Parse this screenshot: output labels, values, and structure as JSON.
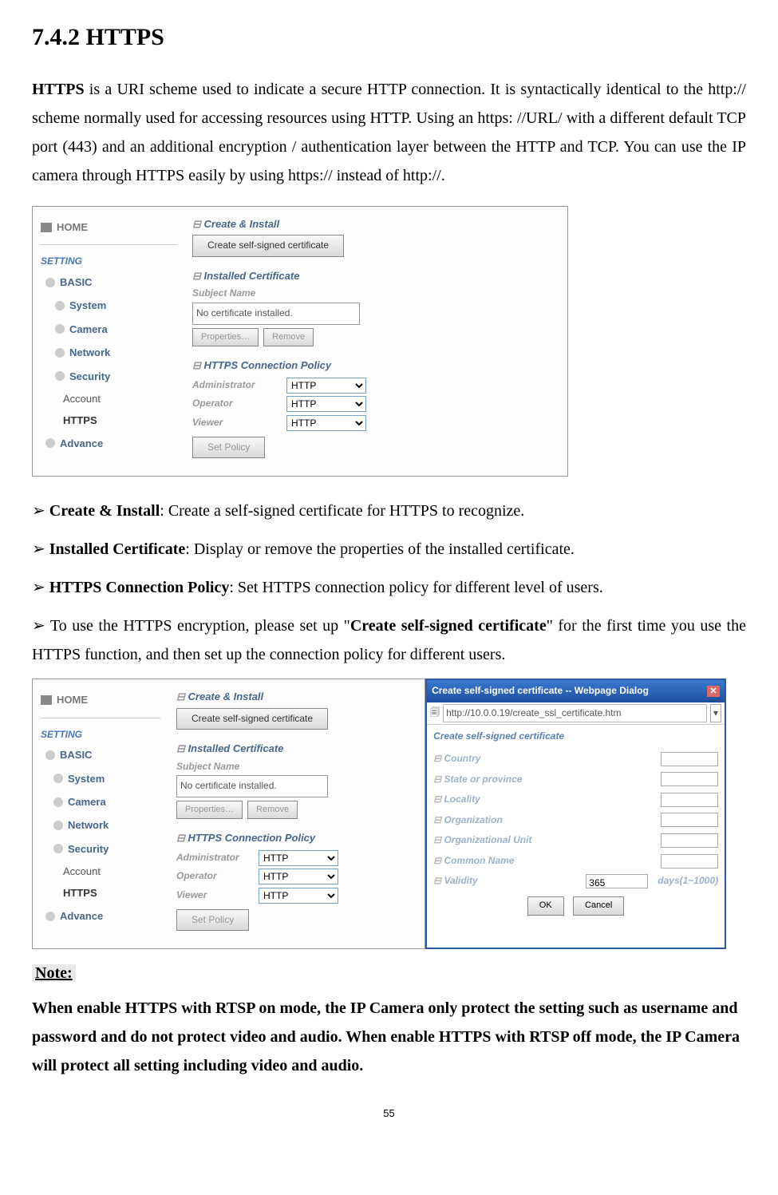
{
  "heading": "7.4.2 HTTPS",
  "intro": {
    "strong": "HTTPS",
    "rest": " is a URI scheme used to indicate a secure HTTP connection. It is syntactically identical to the http:// scheme normally used for accessing resources using HTTP. Using an https: //URL/ with a different default TCP port (443) and an additional encryption / authentication layer between the HTTP and TCP. You can use the IP camera through HTTPS easily by using https:// instead of http://."
  },
  "nav": {
    "home": "HOME",
    "setting": "SETTING",
    "basic": "BASIC",
    "items": [
      "System",
      "Camera",
      "Network",
      "Security"
    ],
    "subs": [
      "Account",
      "HTTPS"
    ],
    "advance": "Advance"
  },
  "pane": {
    "create_install": "Create & Install",
    "create_btn": "Create self-signed certificate",
    "installed_cert": "Installed Certificate",
    "subject_name": "Subject Name",
    "no_cert": "No certificate installed.",
    "properties_btn": "Properties…",
    "remove_btn": "Remove",
    "conn_policy": "HTTPS Connection Policy",
    "roles": [
      "Administrator",
      "Operator",
      "Viewer"
    ],
    "http_opt": "HTTP",
    "set_policy_btn": "Set Policy"
  },
  "bullets": {
    "b1_strong": "Create & Install",
    "b1_rest": ": Create a self-signed certificate for HTTPS to recognize.",
    "b2_strong": "Installed Certificate",
    "b2_rest": ": Display or remove the properties of the installed certificate.",
    "b3_strong": "HTTPS Connection Policy",
    "b3_rest": ": Set HTTPS connection policy for different level of users.",
    "b4_pre": "To use the HTTPS encryption, please set up \"",
    "b4_strong": "Create self-signed certificate",
    "b4_post": "\" for the first time you use the HTTPS function, and then set up the connection policy for different users."
  },
  "dialog": {
    "title": "Create self-signed certificate -- Webpage Dialog",
    "url": "http://10.0.0.19/create_ssl_certificate.htm",
    "heading": "Create self-signed certificate",
    "fields": [
      "Country",
      "State or province",
      "Locality",
      "Organization",
      "Organizational Unit",
      "Common Name",
      "Validity"
    ],
    "validity_value": "365",
    "days_label": "days(1~1000)",
    "ok": "OK",
    "cancel": "Cancel"
  },
  "note_label": "Note:",
  "note_text": "When enable HTTPS with RTSP on mode, the IP Camera only protect the setting such as username and password and do not protect video and audio. When enable HTTPS with RTSP off mode, the IP Camera will protect all setting including video and audio.",
  "pagenum": "55"
}
